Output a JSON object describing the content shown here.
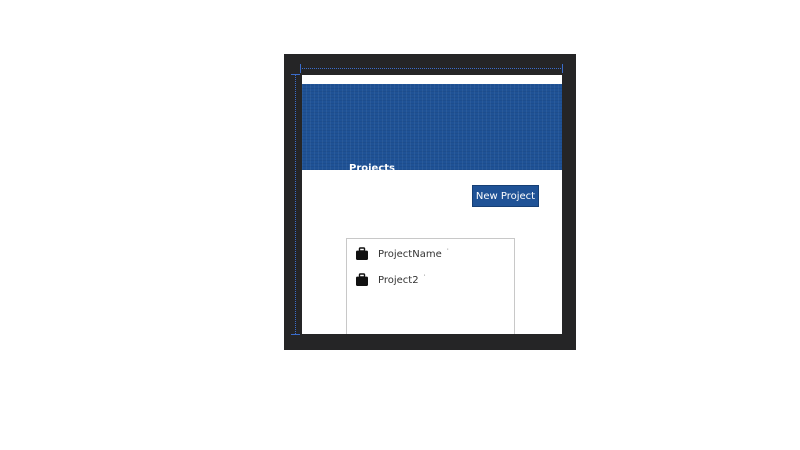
{
  "header": {
    "title": "Projects"
  },
  "toolbar": {
    "new_project_label": "New Project"
  },
  "projects": [
    {
      "name": "ProjectName",
      "marker": "˙",
      "icon": "briefcase-icon"
    },
    {
      "name": "Project2",
      "marker": "˙",
      "icon": "briefcase-icon"
    }
  ],
  "colors": {
    "header_background": "#1f5296",
    "button_background": "#1f5296",
    "frame": "#252526",
    "guide": "#3a6cc9"
  }
}
